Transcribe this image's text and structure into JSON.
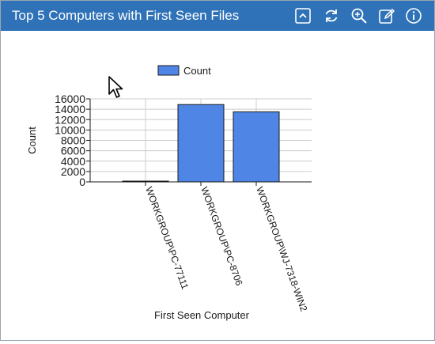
{
  "header": {
    "title": "Top 5 Computers with First Seen Files",
    "icons": [
      "collapse-icon",
      "refresh-icon",
      "zoom-icon",
      "edit-icon",
      "info-icon"
    ]
  },
  "colors": {
    "header_bg": "#2f72b8",
    "bar_fill": "#4f86e6",
    "bar_stroke": "#1a1a1a"
  },
  "chart_data": {
    "type": "bar",
    "categories": [
      "WORKGROUP\\PC-77111",
      "WORKGROUP\\PC-8706",
      "WORKGROUP\\WJ-7318-WIN2"
    ],
    "series": [
      {
        "name": "Count",
        "values": [
          150,
          14900,
          13500
        ]
      }
    ],
    "xlabel": "First Seen Computer",
    "ylabel": "Count",
    "ylim": [
      0,
      16000
    ],
    "yticks": [
      0,
      2000,
      4000,
      6000,
      8000,
      10000,
      12000,
      14000,
      16000
    ],
    "grid": true,
    "legend": "top"
  }
}
